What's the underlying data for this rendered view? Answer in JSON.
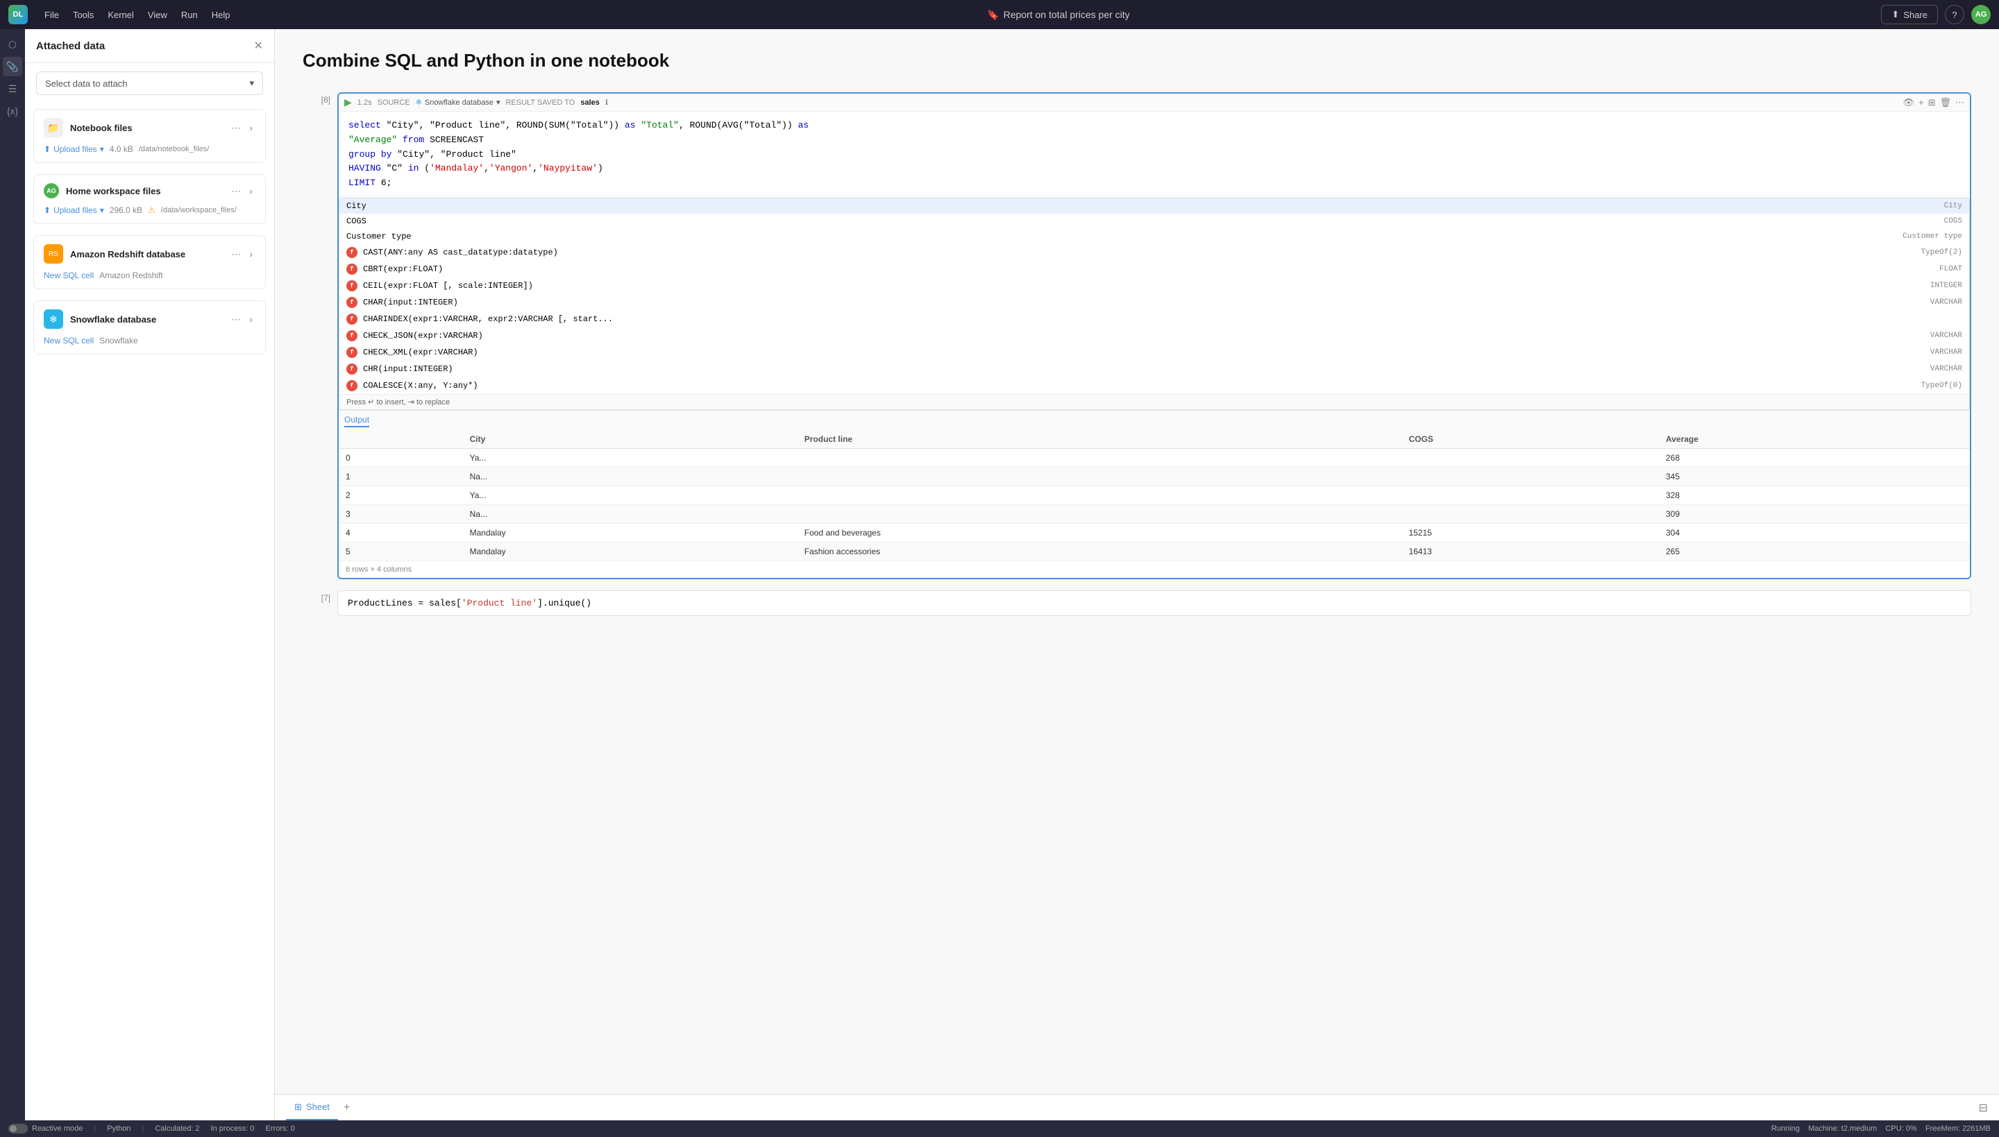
{
  "topbar": {
    "logo": "DL",
    "menu": [
      "File",
      "Tools",
      "Kernel",
      "View",
      "Run",
      "Help"
    ],
    "title": "Report on total prices per city",
    "share_label": "Share",
    "help_label": "?",
    "avatar": "AG"
  },
  "sidebar_icons": [
    "layers-icon",
    "paperclip-icon",
    "list-icon",
    "variable-icon"
  ],
  "attached_panel": {
    "title": "Attached data",
    "select_placeholder": "Select data to attach",
    "cards": [
      {
        "id": "notebook-files",
        "icon": "folder-icon",
        "title": "Notebook files",
        "upload_label": "Upload files",
        "size": "4.0 kB",
        "path": "/data/notebook_files/",
        "has_warning": false
      },
      {
        "id": "home-workspace",
        "icon": "home-icon",
        "title": "Home workspace files",
        "upload_label": "Upload files",
        "size": "296.0 kB",
        "path": "/data/workspace_files/",
        "has_warning": true
      },
      {
        "id": "amazon-redshift",
        "icon": "redshift-icon",
        "title": "Amazon Redshift database",
        "new_sql_label": "New SQL cell",
        "db_name": "Amazon Redshift",
        "has_warning": false
      },
      {
        "id": "snowflake",
        "icon": "snowflake-icon",
        "title": "Snowflake database",
        "new_sql_label": "New SQL cell",
        "db_name": "Snowflake",
        "has_warning": false
      }
    ]
  },
  "notebook": {
    "title": "Combine SQL and Python in one notebook",
    "cells": [
      {
        "number": "[8]",
        "time": "1.2s",
        "source": "SOURCE",
        "source_db": "Snowflake database",
        "result_label": "RESULT SAVED TO",
        "result_name": "sales",
        "code_lines": [
          "select \"City\", \"Product line\", ROUND(SUM(\"Total\")) as \"Total\", ROUND(AVG(\"Total\")) as",
          "\"Average\" from SCREENCAST",
          "group by \"City\", \"Product line\"",
          "HAVING \"C\" in ('Mandalay','Yangon','Naypyitaw')",
          "LIMIT 6;"
        ]
      },
      {
        "number": "[7]",
        "code": "ProductLines = sales['Product line'].unique()"
      }
    ],
    "autocomplete": {
      "items": [
        {
          "name": "City",
          "type": "City",
          "is_func": false,
          "selected": true
        },
        {
          "name": "COGS",
          "type": "COGS",
          "is_func": false,
          "selected": false
        },
        {
          "name": "Customer type",
          "type": "Customer type",
          "is_func": false,
          "selected": false
        },
        {
          "name": "CAST(ANY:any AS cast_datatype:datatype)",
          "type": "TypeOf(2)",
          "is_func": true
        },
        {
          "name": "CBRT(expr:FLOAT)",
          "type": "FLOAT",
          "is_func": true
        },
        {
          "name": "CEIL(expr:FLOAT [, scale:INTEGER])",
          "type": "INTEGER",
          "is_func": true
        },
        {
          "name": "CHAR(input:INTEGER)",
          "type": "VARCHAR",
          "is_func": true
        },
        {
          "name": "CHARINDEX(expr1:VARCHAR, expr2:VARCHAR [, start...",
          "type": "",
          "is_func": true
        },
        {
          "name": "CHECK_JSON(expr:VARCHAR)",
          "type": "VARCHAR",
          "is_func": true
        },
        {
          "name": "CHECK_XML(expr:VARCHAR)",
          "type": "VARCHAR",
          "is_func": true
        },
        {
          "name": "CHR(input:INTEGER)",
          "type": "VARCHAR",
          "is_func": true
        },
        {
          "name": "COALESCE(X:any, Y:any*)",
          "type": "TypeOf(0)",
          "is_func": true
        }
      ],
      "hint": "Press ↵ to insert, ⇥ to replace"
    },
    "output": {
      "tab_label": "Output",
      "columns": [
        "",
        "City",
        "Product line",
        "COGS",
        "Average"
      ],
      "rows": [
        [
          "0",
          "Ya...",
          "",
          "",
          "268"
        ],
        [
          "1",
          "Na...",
          "",
          "",
          "345"
        ],
        [
          "2",
          "Ya...",
          "",
          "",
          "328"
        ],
        [
          "3",
          "Na...",
          "",
          "",
          "309"
        ],
        [
          "4",
          "Mandalay",
          "Food and beverages",
          "15215",
          "304"
        ],
        [
          "5",
          "Mandalay",
          "Fashion accessories",
          "16413",
          "265"
        ]
      ],
      "footer": "6 rows × 4 columns"
    }
  },
  "bottom_tabs": [
    {
      "label": "Sheet",
      "icon": "table-icon",
      "active": true
    }
  ],
  "status_bar": {
    "reactive_mode": "Reactive mode",
    "python_label": "Python",
    "calculated": "Calculated: 2",
    "in_process": "In process: 0",
    "errors": "Errors: 0",
    "running": "Running",
    "machine": "Machine: t2.medium",
    "cpu": "CPU:   0%",
    "free_mem": "FreeMem:    2261MB"
  }
}
